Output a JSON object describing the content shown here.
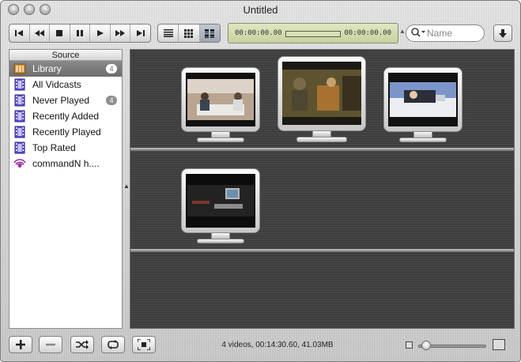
{
  "window": {
    "title": "Untitled"
  },
  "toolbar": {
    "transport_icons": [
      "skip-back-icon",
      "rewind-icon",
      "stop-icon",
      "pause-icon",
      "play-icon",
      "fast-forward-icon",
      "skip-forward-icon"
    ],
    "view_modes": [
      "list-view-icon",
      "small-grid-view-icon",
      "large-grid-view-icon"
    ],
    "time_elapsed": "00:00:00.00",
    "time_remaining": "00:00:00.00",
    "progress": 0,
    "search_placeholder": "Name"
  },
  "sidebar": {
    "header": "Source",
    "items": [
      {
        "label": "Library",
        "icon": "library-icon",
        "badge": "4",
        "selected": true
      },
      {
        "label": "All Vidcasts",
        "icon": "film-icon",
        "badge": "",
        "selected": false
      },
      {
        "label": "Never Played",
        "icon": "film-icon",
        "badge": "4",
        "selected": false
      },
      {
        "label": "Recently Added",
        "icon": "film-icon",
        "badge": "",
        "selected": false
      },
      {
        "label": "Recently Played",
        "icon": "film-icon",
        "badge": "",
        "selected": false
      },
      {
        "label": "Top Rated",
        "icon": "film-icon",
        "badge": "",
        "selected": false
      },
      {
        "label": "commandN h....",
        "icon": "podcast-icon",
        "badge": "",
        "selected": false
      }
    ]
  },
  "content": {
    "videos": [
      {
        "thumbnail": "video-thumbnail-1"
      },
      {
        "thumbnail": "video-thumbnail-2"
      },
      {
        "thumbnail": "video-thumbnail-3"
      },
      {
        "thumbnail": "video-thumbnail-4"
      }
    ]
  },
  "statusbar": {
    "text": "4 videos, 00:14:30.60, 41.03MB",
    "zoom_level": 0.12
  },
  "colors": {
    "selection": "#7a7a7a",
    "lcd": "#d1daa9",
    "podcast": "#9b2fa6"
  }
}
